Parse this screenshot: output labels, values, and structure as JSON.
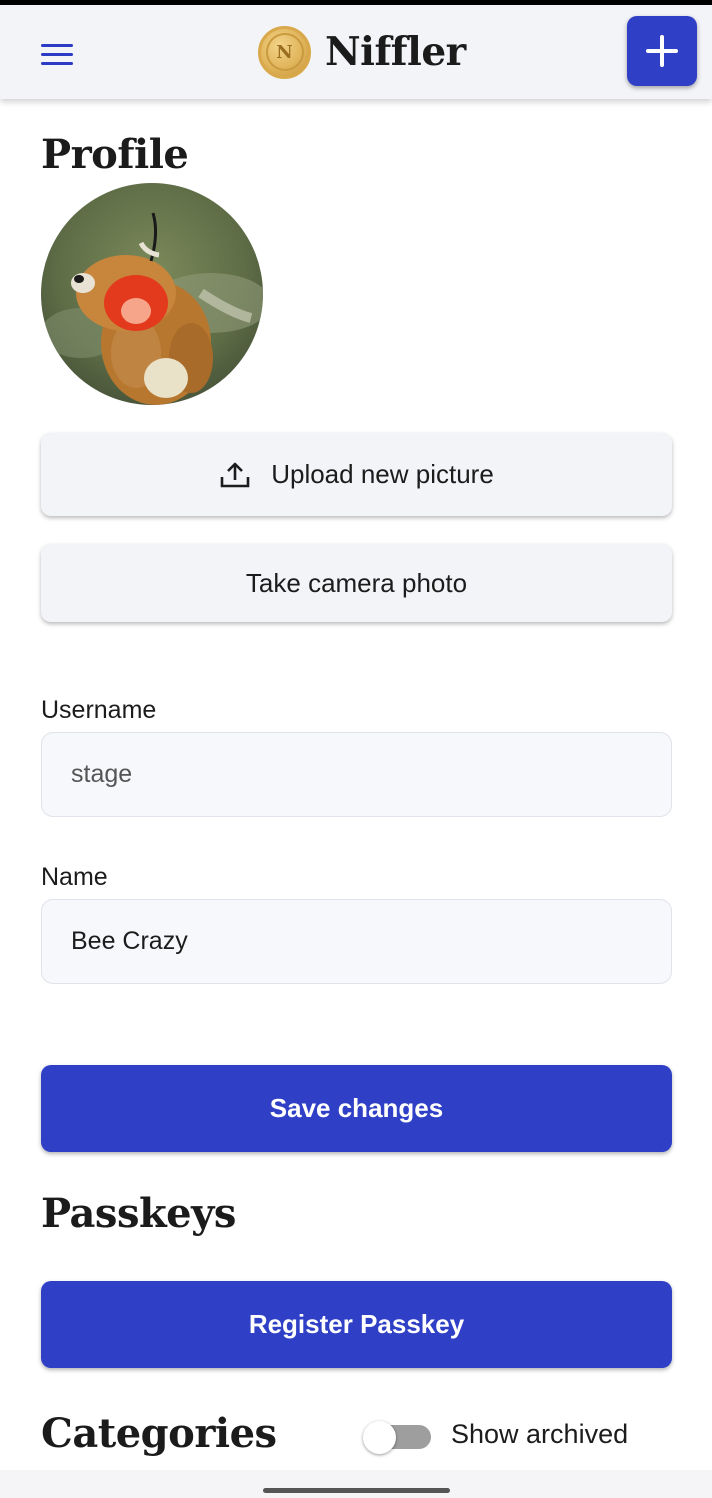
{
  "header": {
    "app_name": "Niffler",
    "logo_letter": "N",
    "menu_icon": "hamburger-menu-icon",
    "add_icon": "plus-icon",
    "accent_color": "#2f40c7"
  },
  "profile": {
    "title": "Profile",
    "avatar_alt": "profile avatar",
    "upload_label": "Upload new picture",
    "upload_icon": "upload-icon",
    "camera_label": "Take camera photo",
    "username_label": "Username",
    "username_value": "stage",
    "name_label": "Name",
    "name_value": "Bee Crazy",
    "save_label": "Save changes"
  },
  "passkeys": {
    "title": "Passkeys",
    "register_label": "Register Passkey"
  },
  "categories": {
    "title": "Categories",
    "show_archived_label": "Show archived",
    "show_archived_on": false
  }
}
